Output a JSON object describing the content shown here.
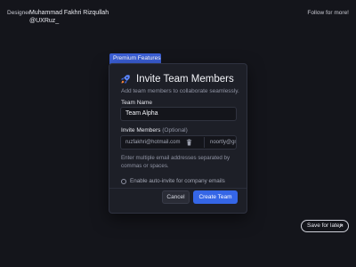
{
  "header": {
    "designer_label": "Designer",
    "designer_name": "Muhammad Fakhri Rizqullah",
    "designer_handle": "@UXRuz_",
    "follow_label": "Follow for more!"
  },
  "modal": {
    "tab_label": "Premium Features",
    "icon": "rocket-icon",
    "title": "Invite Team Members",
    "subtitle": "Add team members to collaborate seamlessly.",
    "team_name": {
      "label": "Team Name",
      "value": "Team Alpha"
    },
    "invite": {
      "label": "Invite Members",
      "optional": "(Optional)",
      "emails": [
        "ruzfakhri@hotmail.com",
        "noortly@gmail"
      ],
      "helper": "Enter multiple email addresses separated by commas or spaces."
    },
    "auto_invite": {
      "label": "Enable auto-invite for company emails",
      "checked": false
    },
    "cancel_label": "Cancel",
    "create_label": "Create Team"
  },
  "footer": {
    "save_label": "Save for later"
  },
  "colors": {
    "background": "#14151b",
    "card": "#1d1f27",
    "accent": "#3566e6",
    "tab": "#3b5fd6"
  }
}
